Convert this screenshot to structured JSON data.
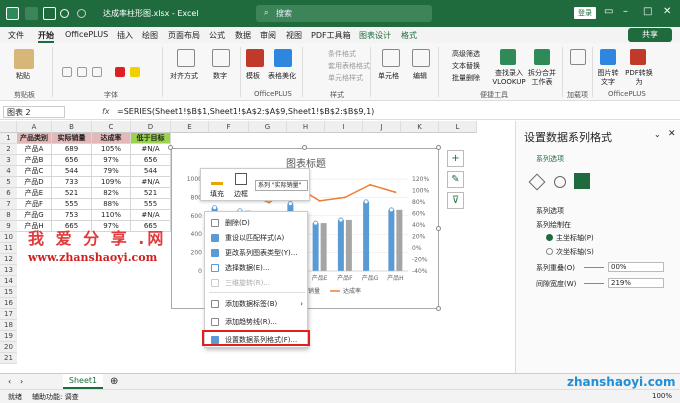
{
  "titlebar": {
    "autosave": "自动保存",
    "autosave_state": "关",
    "filename": "达成率柱形图.xlsx - Excel",
    "search_placeholder": "搜索",
    "login": "登录"
  },
  "menu": [
    "文件",
    "开始",
    "OfficePLUS",
    "插入",
    "绘图",
    "页面布局",
    "公式",
    "数据",
    "审阅",
    "视图",
    "PDF工具箱",
    "图表设计",
    "格式"
  ],
  "share": "共享",
  "ribbon": {
    "paste": "粘贴",
    "clipboard": "剪贴板",
    "font": "字体",
    "align": "对齐方式",
    "number": "数字",
    "template": "模板",
    "beautify": "表格美化",
    "officeplus": "OfficePLUS",
    "cond_format": "条件格式",
    "table_format": "套用表格格式",
    "cell_style": "单元格样式",
    "style": "样式",
    "cells": "单元格",
    "edit": "编辑",
    "advfilter": "高级筛选",
    "text_replace": "文本替换",
    "batch_edit": "批量删除",
    "vlookup": "查找录入 VLOOKUP",
    "split_merge": "拆分合并 工作表",
    "convenience": "便捷工具",
    "addins": "加载项",
    "img_to_text": "图片转 文字",
    "pdf_convert": "PDF转换 为",
    "officeplus2": "OfficePLUS"
  },
  "formula": {
    "namebox": "图表 2",
    "fx": "fx",
    "text": "=SERIES(Sheet1!$B$1,Sheet1!$A$2:$A$9,Sheet1!$B$2:$B$9,1)"
  },
  "columns": [
    "A",
    "B",
    "C",
    "D",
    "E",
    "F",
    "G",
    "H",
    "I",
    "J",
    "K",
    "L"
  ],
  "rows": [
    "1",
    "2",
    "3",
    "4",
    "5",
    "6",
    "7",
    "8",
    "9",
    "10",
    "11",
    "12",
    "13",
    "14",
    "15",
    "16",
    "17",
    "18",
    "19",
    "20",
    "21"
  ],
  "table": {
    "headers": [
      "产品类别",
      "实际销量",
      "达成率",
      "低于目标"
    ],
    "rows": [
      [
        "产品A",
        "689",
        "105%",
        "#N/A"
      ],
      [
        "产品B",
        "656",
        "97%",
        "656"
      ],
      [
        "产品C",
        "544",
        "79%",
        "544"
      ],
      [
        "产品D",
        "733",
        "109%",
        "#N/A"
      ],
      [
        "产品E",
        "521",
        "82%",
        "521"
      ],
      [
        "产品F",
        "555",
        "88%",
        "555"
      ],
      [
        "产品G",
        "753",
        "110%",
        "#N/A"
      ],
      [
        "产品H",
        "665",
        "97%",
        "665"
      ]
    ]
  },
  "chart_data": {
    "type": "bar",
    "title": "图表标题",
    "categories": [
      "产品A",
      "产品B",
      "产品C",
      "产品D",
      "产品E",
      "产品F",
      "产品G",
      "产品H"
    ],
    "series": [
      {
        "name": "实际销量",
        "type": "bar",
        "values": [
          689,
          656,
          544,
          733,
          521,
          555,
          753,
          665
        ],
        "color": "#5b9bd5"
      },
      {
        "name": "低于目标",
        "type": "bar",
        "values": [
          null,
          656,
          544,
          null,
          521,
          555,
          null,
          665
        ],
        "color": "#a5a5a5"
      },
      {
        "name": "达成率",
        "type": "line",
        "axis": "secondary",
        "values": [
          1.05,
          0.97,
          0.79,
          1.09,
          0.82,
          0.88,
          1.1,
          0.97
        ],
        "color": "#ed7d31"
      }
    ],
    "ylim": [
      0,
      1000
    ],
    "y_ticks": [
      "0",
      "200",
      "400",
      "600",
      "800",
      "1000"
    ],
    "y2lim": [
      -0.4,
      1.2
    ],
    "y2_ticks": [
      "120%",
      "100%",
      "80%",
      "60%",
      "40%",
      "20%",
      "0%",
      "-20%",
      "-40%"
    ],
    "legend_visible": [
      "实际销量",
      "达成率"
    ],
    "legend_placement": "bottom"
  },
  "minitoolbar": {
    "fill": "填充",
    "border": "边框",
    "series_select": "系列 \"实际销量\""
  },
  "context_menu": [
    {
      "label": "删除(D)",
      "icon": "delete-icon",
      "disabled": false
    },
    {
      "label": "重设以匹配样式(A)",
      "icon": "reset-icon",
      "disabled": false
    },
    {
      "label": "更改系列图表类型(Y)...",
      "icon": "chart-type-icon",
      "disabled": false
    },
    {
      "label": "选择数据(E)...",
      "icon": "select-data-icon",
      "disabled": false
    },
    {
      "label": "三维旋转(R)...",
      "icon": "rotate-3d-icon",
      "disabled": true
    },
    {
      "label": "添加数据标签(B)",
      "icon": "data-label-icon",
      "disabled": false
    },
    {
      "label": "添加趋势线(R)...",
      "icon": "trendline-icon",
      "disabled": false
    },
    {
      "label": "设置数据系列格式(F)...",
      "icon": "format-series-icon",
      "disabled": false
    }
  ],
  "pane": {
    "title": "设置数据系列格式",
    "section": "系列选项",
    "sub": "系列选项",
    "plot_on": "系列绘制在",
    "primary": "主坐标轴(P)",
    "secondary": "次坐标轴(S)",
    "overlap_label": "系列重叠(O)",
    "overlap_value": "00%",
    "gap_label": "间隙宽度(W)",
    "gap_value": "219%"
  },
  "sheet_tab": "Sheet1",
  "status": {
    "ready": "就绪",
    "accessibility": "辅助功能: 调查",
    "zoom": "100%"
  },
  "watermark": {
    "cn": "我 爱 分 享 .网",
    "url": "www.zhanshaoyi.com",
    "corner": "zhanshaoyi.com"
  },
  "colors": {
    "excel_green": "#1f6b3e",
    "bar_blue": "#5b9bd5",
    "bar_gray": "#a5a5a5",
    "line_orange": "#ed7d31",
    "highlight_red": "#e0201c",
    "header_pink": "#e3b8b8",
    "header_green": "#9bd34c"
  }
}
